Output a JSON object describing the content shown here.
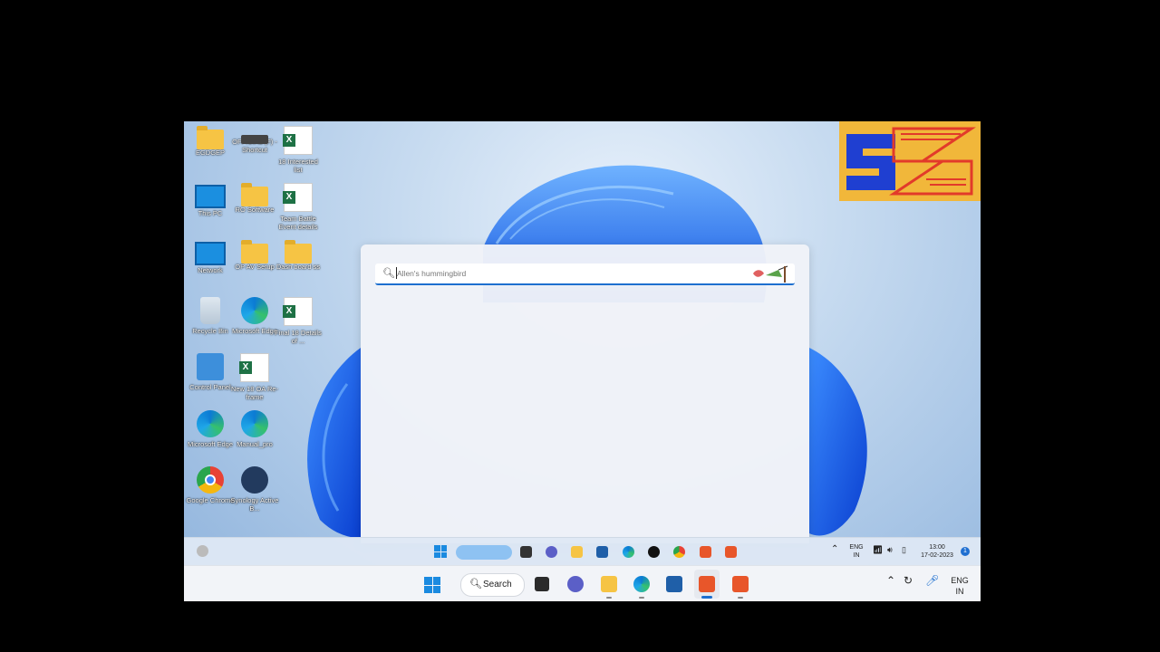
{
  "desktop": {
    "icons": [
      {
        "label": "EGDGEP",
        "type": "folder"
      },
      {
        "label": "OFFICIAL (F) - Shortcut",
        "type": "drive"
      },
      {
        "label": "18 Interested list",
        "type": "excel"
      },
      {
        "label": "This PC",
        "type": "pc"
      },
      {
        "label": "RO Software",
        "type": "folder"
      },
      {
        "label": "Team Battle Event details",
        "type": "excel"
      },
      {
        "label": "Network",
        "type": "network"
      },
      {
        "label": "OP AV Setup",
        "type": "folder"
      },
      {
        "label": "Dash board ss",
        "type": "folder"
      },
      {
        "label": "Recycle Bin",
        "type": "bin"
      },
      {
        "label": "Microsoft Edge",
        "type": "edge"
      },
      {
        "label": "Final 18 Details of ...",
        "type": "excel"
      },
      {
        "label": "Control Panel",
        "type": "control"
      },
      {
        "label": "New 18 OA Re-frame",
        "type": "excel"
      },
      {
        "label": "Microsoft Edge",
        "type": "edge"
      },
      {
        "label": "Manual_pro",
        "type": "edge"
      },
      {
        "label": "Google Chrome",
        "type": "chrome"
      },
      {
        "label": "Synology Active B...",
        "type": "synology"
      }
    ]
  },
  "logo": {
    "text": "SZ",
    "colors": {
      "bg": "#f1b73a",
      "letter": "#1f3fd1",
      "accent": "#e23a2a"
    }
  },
  "search_panel": {
    "placeholder": "Allen's hummingbird",
    "icon": "search-icon",
    "highlight_icon": "hummingbird-icon"
  },
  "taskbar_inner": {
    "lang": "ENG",
    "region": "IN",
    "time": "13:00",
    "date": "17-02-2023",
    "notification_count": "1"
  },
  "taskbar": {
    "search_label": "Search",
    "lang": "ENG",
    "region": "IN",
    "apps": [
      "start-icon",
      "search",
      "task-view-icon",
      "chat-icon",
      "file-explorer-icon",
      "edge-icon",
      "store-icon",
      "camtasia-recorder-icon",
      "camtasia-editor-icon"
    ]
  }
}
